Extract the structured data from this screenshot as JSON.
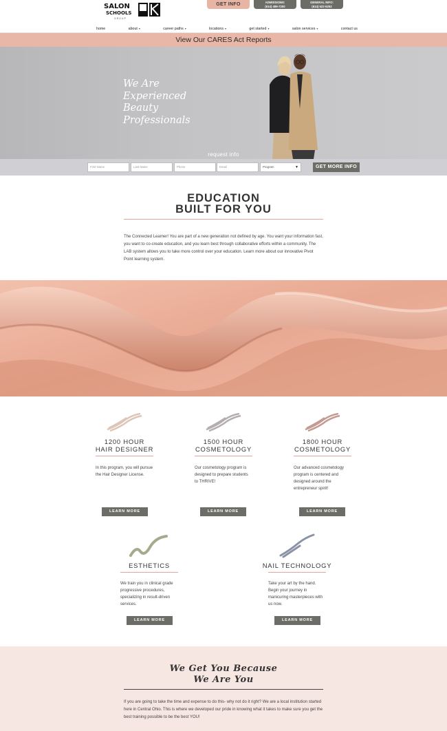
{
  "header": {
    "logo_text": "SALON SCHOOLS GROUP",
    "get_info_label": "GET INFO",
    "admissions": {
      "label": "ADMISSIONS:",
      "phone": "(614) 499-7200"
    },
    "general": {
      "label": "GENERAL INFO:",
      "phone": "(614) 522-5252"
    }
  },
  "nav": {
    "items": [
      {
        "label": "home",
        "dropdown": false
      },
      {
        "label": "about",
        "dropdown": true
      },
      {
        "label": "career paths",
        "dropdown": true
      },
      {
        "label": "locations",
        "dropdown": true
      },
      {
        "label": "get started",
        "dropdown": true
      },
      {
        "label": "salon services",
        "dropdown": true
      },
      {
        "label": "contact us",
        "dropdown": false
      }
    ],
    "caret": "▾"
  },
  "cares_banner": "View Our CARES Act Reports",
  "hero": {
    "lines": [
      "We Are",
      "Experienced",
      "Beauty",
      "Professionals"
    ],
    "request_tab": "request info"
  },
  "form": {
    "first_name": "First Name",
    "last_name": "Last Name",
    "phone": "Phone",
    "email": "Email",
    "program": "Program",
    "submit": "GET MORE INFO"
  },
  "education": {
    "title_line1": "EDUCATION",
    "title_line2": "BUILT FOR YOU",
    "text": "The Connected Learner! You are part of a new generation not defined by age. You want your information fast, you want to co-create education, and you learn best through collaborative efforts within a community. The LAB system allows you to take more control over your education. Learn more about our innovative Pivot Point learning system."
  },
  "programs": [
    {
      "title1": "1200 HOUR",
      "title2": "HAIR DESIGNER",
      "text": "In this program, you will pursue the Hair Designer License.",
      "button": "LEARN MORE",
      "stroke_color": "#d4b8a6"
    },
    {
      "title1": "1500 HOUR",
      "title2": "COSMETOLOGY",
      "text": "Our cosmetology program is designed to prepare students to THRIVE!",
      "button": "LEARN MORE",
      "stroke_color": "#a89fa3"
    },
    {
      "title1": "1800 HOUR",
      "title2": "COSMETOLOGY",
      "text": "Our advanced cosmetology program is centered and designed around the entrepreneur spirit!",
      "button": "LEARN MORE",
      "stroke_color": "#b88a80"
    },
    {
      "title1": "ESTHETICS",
      "title2": "",
      "text": "We train you in clinical grade progressive procedures, specializing in result-driven services.",
      "button": "LEARN MORE",
      "stroke_color": "#a7a98c"
    },
    {
      "title1": "NAIL TECHNOLOGY",
      "title2": "",
      "text": "Take your art by the hand. Begin your journey in manicuring masterpieces with us now.",
      "button": "LEARN MORE",
      "stroke_color": "#8a93a6"
    }
  ],
  "bottom": {
    "title_line1": "We Get You Because",
    "title_line2": "We Are You",
    "text": "If you are going to take the time and expense to do this- why not do it right? We are a local institution started here in Central Ohio. This is where we developed our pride in knowing what it takes to make sure you get the best training possible to be the best YOU!"
  }
}
